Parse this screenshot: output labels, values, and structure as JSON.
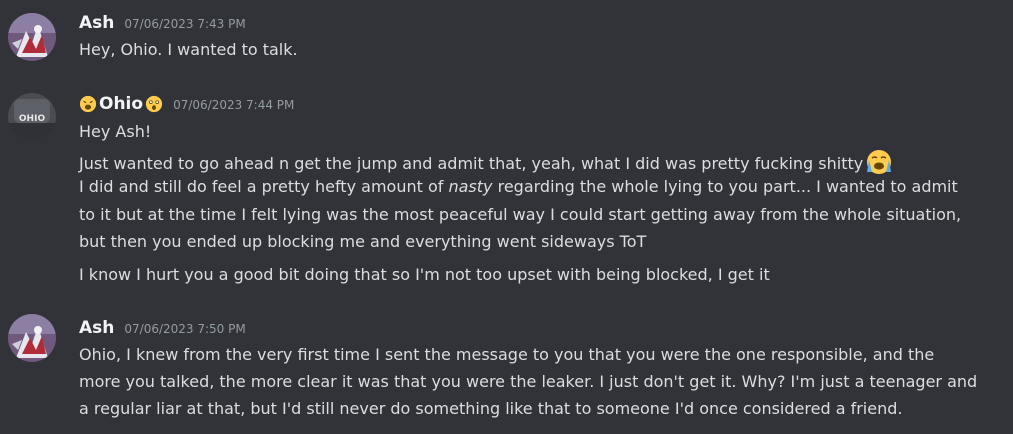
{
  "messages": [
    {
      "author": "Ash",
      "timestamp": "07/06/2023 7:43 PM",
      "lines": [
        "Hey, Ohio. I wanted to talk."
      ]
    },
    {
      "author": "Ohio",
      "author_prefix_emoji": "weary-face",
      "author_suffix_emoji": "astonished-face",
      "avatar_text": "OHIO",
      "timestamp": "07/06/2023 7:44 PM",
      "lines": [
        "Hey Ash!",
        "Just wanted to go ahead n get the jump and admit that, yeah, what I did was pretty fucking shitty",
        "I did and still do feel a pretty hefty amount of ",
        "nasty",
        " regarding the whole lying to you part... I wanted to admit",
        "to it but at the time I felt lying was the most peaceful way I could start getting away from the whole situation,",
        "but then you ended up blocking me and everything went sideways ToT",
        "I know I hurt you a good bit doing that so I'm not too upset with being blocked, I get it"
      ],
      "inline_emoji": "loudly-crying-face"
    },
    {
      "author": "Ash",
      "timestamp": "07/06/2023 7:50 PM",
      "lines": [
        "Ohio, I knew from the very first time I sent the message to you that you were the one responsible, and the",
        "more you talked, the more clear it was that you were the leaker. I just don't get it. Why? I'm just a teenager and",
        "a regular liar at that, but I'd still never do something like that to someone I'd once considered a friend."
      ]
    }
  ],
  "colors": {
    "background": "#313338",
    "text": "#dbdee1",
    "username": "#f2f3f5",
    "timestamp": "#949ba4"
  }
}
